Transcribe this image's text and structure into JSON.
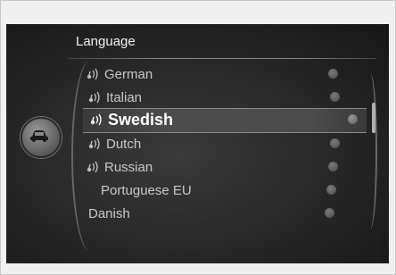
{
  "header": {
    "title": "Language"
  },
  "languages": [
    {
      "label": "German",
      "voice": true,
      "selected": false
    },
    {
      "label": "Italian",
      "voice": true,
      "selected": false
    },
    {
      "label": "Swedish",
      "voice": true,
      "selected": true
    },
    {
      "label": "Dutch",
      "voice": true,
      "selected": false
    },
    {
      "label": "Russian",
      "voice": true,
      "selected": false
    },
    {
      "label": "Portuguese EU",
      "voice": false,
      "selected": false
    },
    {
      "label": "Danish",
      "voice": false,
      "selected": false
    }
  ],
  "sidebar": {
    "icon": "car-icon"
  },
  "image_code": "G049104",
  "colors": {
    "screen_bg": "#262626",
    "text": "#c9c9c9",
    "selected_text": "#ffffff"
  }
}
